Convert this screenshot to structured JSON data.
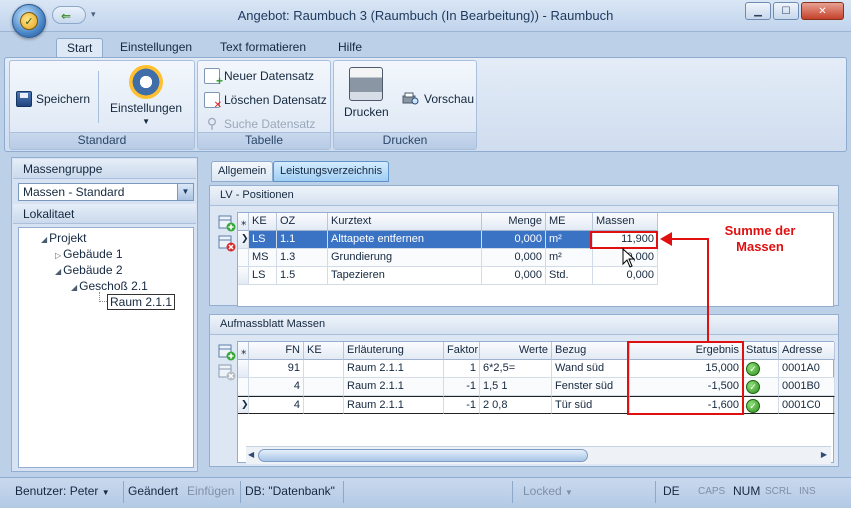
{
  "window": {
    "title": "Angebot: Raumbuch 3  (Raumbuch  (In Bearbeitung))  - Raumbuch"
  },
  "ribbon": {
    "tabs": [
      "Start",
      "Einstellungen",
      "Text formatieren",
      "Hilfe"
    ],
    "groups": {
      "standard": {
        "label": "Standard",
        "save": "Speichern",
        "settings": "Einstellungen"
      },
      "tabelle": {
        "label": "Tabelle",
        "new": "Neuer Datensatz",
        "delete": "Löschen Datensatz",
        "search": "Suche Datensatz"
      },
      "drucken": {
        "label": "Drucken",
        "print": "Drucken",
        "preview": "Vorschau"
      }
    }
  },
  "left": {
    "massengruppe_label": "Massengruppe",
    "massengruppe_value": "Massen - Standard",
    "lokalitaet_label": "Lokalitaet",
    "tree": [
      "Projekt",
      "Gebäude 1",
      "Gebäude 2",
      "Geschoß 2.1",
      "Raum 2.1.1"
    ]
  },
  "content_tabs": [
    "Allgemein",
    "Leistungsverzeichnis"
  ],
  "lv": {
    "title": "LV - Positionen",
    "columns": [
      "KE",
      "OZ",
      "Kurztext",
      "Menge",
      "ME",
      "Massen"
    ],
    "rows": [
      [
        "LS",
        "1.1",
        "Alttapete entfernen",
        "0,000",
        "m²",
        "11,900"
      ],
      [
        "MS",
        "1.3",
        "Grundierung",
        "0,000",
        "m²",
        "0,000"
      ],
      [
        "LS",
        "1.5",
        "Tapezieren",
        "0,000",
        "Std.",
        "0,000"
      ]
    ]
  },
  "aufmass": {
    "title": "Aufmassblatt Massen",
    "columns": [
      "FN",
      "KE",
      "Erläuterung",
      "Faktor",
      "Werte",
      "Bezug",
      "Ergebnis",
      "Status",
      "Adresse"
    ],
    "rows": [
      [
        "91",
        "",
        "Raum 2.1.1",
        "1",
        "6*2,5=",
        "Wand süd",
        "15,000",
        "ok",
        "0001A0"
      ],
      [
        "4",
        "",
        "Raum 2.1.1",
        "-1",
        "1,5 1",
        "Fenster süd",
        "-1,500",
        "ok",
        "0001B0"
      ],
      [
        "4",
        "",
        "Raum 2.1.1",
        "-1",
        "2 0,8",
        "Tür süd",
        "-1,600",
        "ok",
        "0001C0"
      ]
    ]
  },
  "annotation": {
    "line1": "Summe der",
    "line2": "Massen",
    "color": "#e01010"
  },
  "statusbar": {
    "user": "Benutzer: Peter",
    "changed": "Geändert",
    "insert": "Einfügen",
    "db": "DB: \"Datenbank\"",
    "locked": "Locked",
    "lang": "DE",
    "caps": "CAPS",
    "num": "NUM",
    "scrl": "SCRL",
    "ins": "INS"
  }
}
